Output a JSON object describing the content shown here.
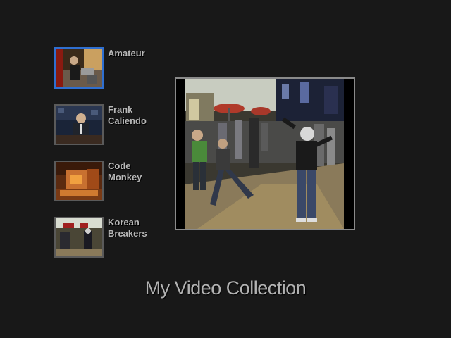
{
  "title": "My Video Collection",
  "menu": {
    "selected_index": 0,
    "items": [
      {
        "label": "Amateur"
      },
      {
        "label": "Frank\nCaliendo"
      },
      {
        "label": "Code\nMonkey"
      },
      {
        "label": "Korean\nBreakers"
      }
    ]
  },
  "colors": {
    "background": "#181818",
    "selected_border": "#2f6fd0",
    "thumb_border": "#5a5a5a",
    "preview_border": "#8a8a8a",
    "text": "#b9b9b9"
  }
}
